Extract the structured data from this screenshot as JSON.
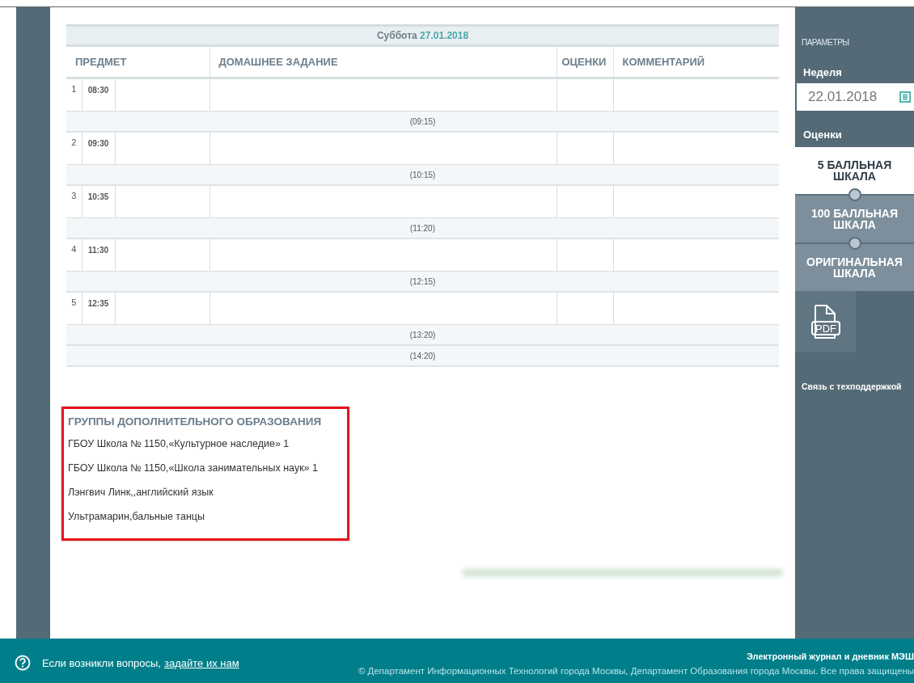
{
  "table": {
    "day": {
      "weekday": "Суббота",
      "date": "27.01.2018"
    },
    "columns": [
      "ПРЕДМЕТ",
      "ДОМАШНЕЕ ЗАДАНИЕ",
      "ОЦЕНКИ",
      "КОММЕНТАРИЙ"
    ],
    "rows": [
      {
        "kind": "lesson",
        "number": "1",
        "time": "08:30"
      },
      {
        "kind": "break",
        "time": "(09:15)"
      },
      {
        "kind": "lesson",
        "number": "2",
        "time": "09:30"
      },
      {
        "kind": "break",
        "time": "(10:15)"
      },
      {
        "kind": "lesson",
        "number": "3",
        "time": "10:35"
      },
      {
        "kind": "break",
        "time": "(11:20)"
      },
      {
        "kind": "lesson",
        "number": "4",
        "time": "11:30"
      },
      {
        "kind": "break",
        "time": "(12:15)"
      },
      {
        "kind": "lesson",
        "number": "5",
        "time": "12:35"
      },
      {
        "kind": "break",
        "time": "(13:20)"
      },
      {
        "kind": "break",
        "time": "(14:20)"
      }
    ]
  },
  "groups": {
    "title": "ГРУППЫ ДОПОЛНИТЕЛЬНОГО ОБРАЗОВАНИЯ",
    "items": [
      "ГБОУ Школа № 1150,«Культурное наследие» 1",
      "ГБОУ Школа № 1150,«Школа занимательных наук» 1",
      "Лэнгвич Линк,,английский язык",
      "Ультрамарин,бальные танцы"
    ]
  },
  "sidebar": {
    "title": "ПАРАМЕТРЫ",
    "week_label": "Неделя",
    "week_value": "22.01.2018",
    "grades_label": "Оценки",
    "scales": [
      {
        "label": "5 БАЛЛЬНАЯ ШКАЛА",
        "selected": true
      },
      {
        "label": "100 БАЛЛЬНАЯ ШКАЛА",
        "selected": false
      },
      {
        "label": "ОРИГИНАЛЬНАЯ ШКАЛА",
        "selected": false
      }
    ],
    "pdf_label": "PDF",
    "support_link": "Связь с техподдержкой"
  },
  "footer": {
    "question_text": "Если возникли вопросы,",
    "question_link": "задайте их нам",
    "app_name": "Электронный журнал и дневник МЭШ",
    "copyright": "© Департамент Информационных Технологий города Москвы, Департамент Образования города Москвы. Все права защищены"
  }
}
